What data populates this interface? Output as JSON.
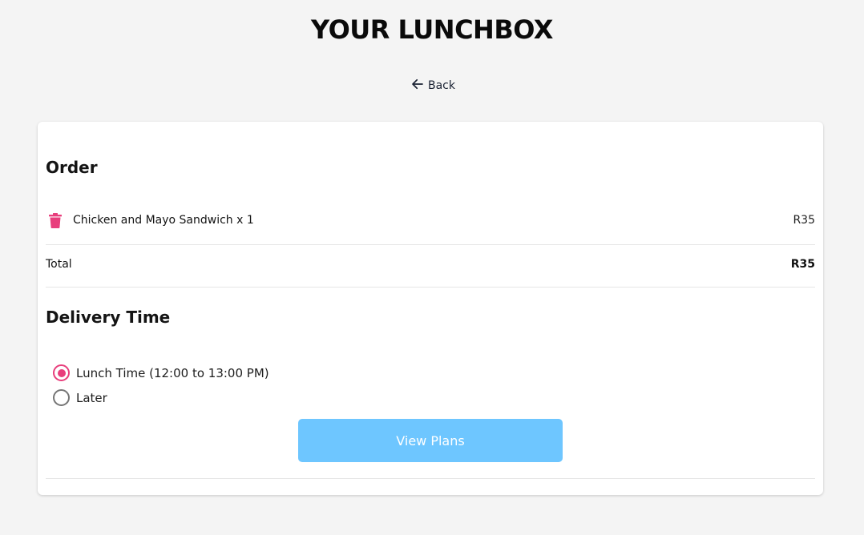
{
  "header": {
    "title": "YOUR LUNCHBOX",
    "back_label": "Back"
  },
  "order": {
    "heading": "Order",
    "items": [
      {
        "name": "Chicken and Mayo Sandwich x 1",
        "price": "R35",
        "remove_icon": "trash-icon"
      }
    ],
    "total_label": "Total",
    "total_value": "R35"
  },
  "delivery": {
    "heading": "Delivery Time",
    "options": [
      {
        "label": "Lunch Time (12:00 to 13:00 PM)",
        "selected": true
      },
      {
        "label": "Later",
        "selected": false
      }
    ]
  },
  "actions": {
    "view_plans_label": "View Plans"
  },
  "colors": {
    "accent": "#e83e7c",
    "button": "#6ec6ff",
    "background": "#f4f4f4",
    "card": "#ffffff"
  }
}
